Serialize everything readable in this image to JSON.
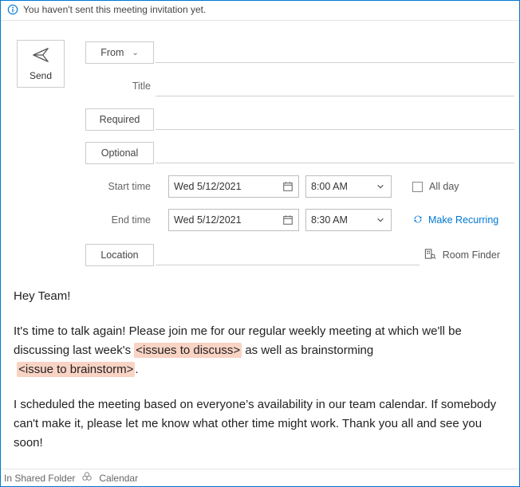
{
  "info_bar": {
    "text": "You haven't sent this meeting invitation yet."
  },
  "send": {
    "label": "Send"
  },
  "fields": {
    "from_label": "From",
    "title_label": "Title",
    "required_label": "Required",
    "optional_label": "Optional",
    "start_time_label": "Start time",
    "end_time_label": "End time",
    "location_label": "Location",
    "title_value": "",
    "required_value": "",
    "optional_value": "",
    "location_value": ""
  },
  "datetime": {
    "start_date": "Wed 5/12/2021",
    "start_time": "8:00 AM",
    "end_date": "Wed 5/12/2021",
    "end_time": "8:30 AM",
    "all_day_label": "All day",
    "recurring_label": "Make Recurring"
  },
  "room_finder_label": "Room Finder",
  "body": {
    "greeting": "Hey Team!",
    "p2_part1": "It's time to talk again! Please join me for our regular weekly meeting at which we'll be discussing last week's ",
    "p2_hl1": "<issues to discuss>",
    "p2_part2": " as well as brainstorming ",
    "p2_hl2": "<issue to brainstorm>",
    "p2_part3": ".",
    "p3": "I scheduled the meeting based on everyone’s availability in our team calendar. If somebody can't make it, please let me know what other time might work. Thank you all and see you soon!"
  },
  "status": {
    "left": "In Shared Folder",
    "folder": "Calendar"
  }
}
